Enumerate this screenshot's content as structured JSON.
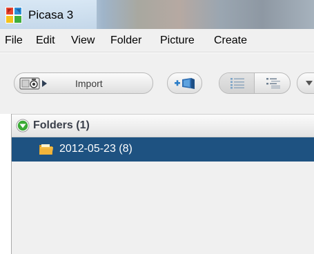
{
  "window": {
    "title": "Picasa 3"
  },
  "menu": {
    "items": [
      "File",
      "Edit",
      "View",
      "Folder",
      "Picture",
      "Create"
    ]
  },
  "toolbar": {
    "import_label": "Import"
  },
  "library": {
    "folders_header": "Folders (1)",
    "folders": [
      {
        "label": "2012-05-23 (8)",
        "selected": true
      }
    ]
  },
  "colors": {
    "selection": "#1e5281",
    "collapse_icon": "#3aaa35",
    "folder_icon": "#f2b43a"
  },
  "icons": {
    "app": "picasa-logo",
    "import": "camera-arrow-icon",
    "add": "add-to-album-icon",
    "view_list": "list-view-icon",
    "view_detail": "detail-list-view-icon",
    "more": "chevron-down-icon",
    "collapse": "collapse-arrow-icon",
    "folder": "folder-icon"
  }
}
